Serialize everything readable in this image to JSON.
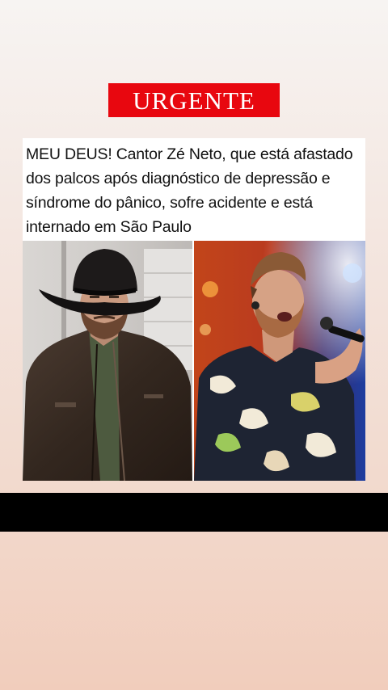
{
  "story": {
    "badge_label": "URGENTE",
    "headline": "MEU DEUS! Cantor Zé Neto, que está afastado dos palcos após diagnóstico de depressão e síndrome do pânico, sofre acidente e está internado em São Paulo"
  },
  "colors": {
    "badge_background": "#e8070f",
    "badge_text": "#ffffff",
    "headline_text": "#111111",
    "bar": "#000000"
  }
}
